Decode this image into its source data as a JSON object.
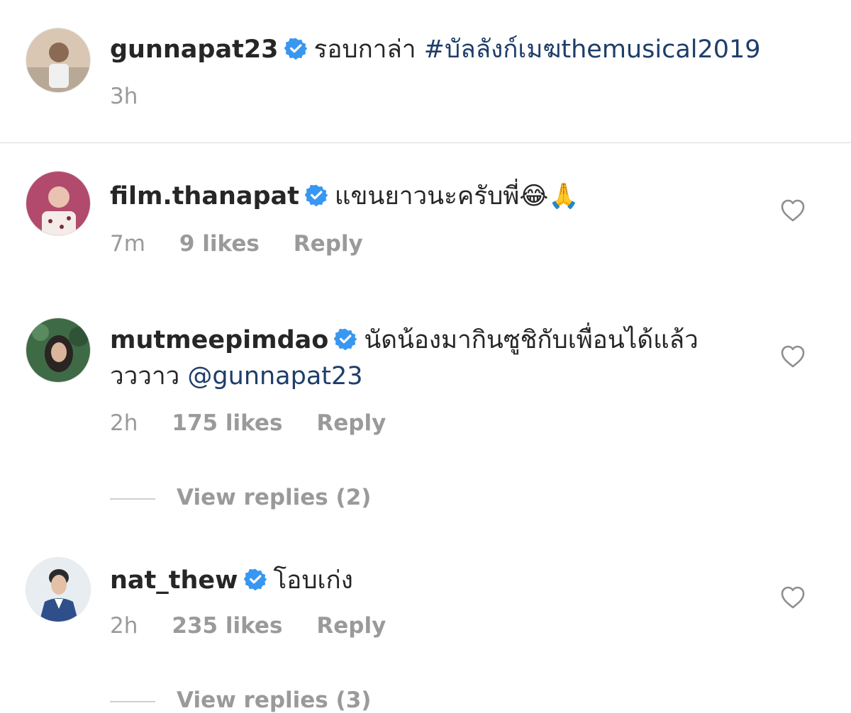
{
  "caption": {
    "username": "gunnapat23",
    "text": "รอบกาล่า",
    "hashtag": "#บัลลังก์เมฆthemusical2019",
    "time": "3h"
  },
  "comments": [
    {
      "username": "film.thanapat",
      "text": "แขนยาวนะครับพี่😂🙏",
      "time": "7m",
      "likes": "9 likes",
      "reply": "Reply"
    },
    {
      "username": "mutmeepimdao",
      "text_line1": "นัดน้องมากินซูชิกับเพื่อนได้แล้ว",
      "text_line2": "วววาว",
      "mention": "@gunnapat23",
      "time": "2h",
      "likes": "175 likes",
      "reply": "Reply",
      "view_replies": "View replies (2)"
    },
    {
      "username": "nat_thew",
      "text": "โอบเก่ง",
      "time": "2h",
      "likes": "235 likes",
      "reply": "Reply",
      "view_replies": "View replies (3)"
    }
  ],
  "colors": {
    "verified": "#3897f0",
    "link": "#1e3e6b",
    "muted": "#9a9a9a",
    "divider": "#dbdbdb"
  },
  "icons": {
    "verified": "verified-badge-icon",
    "heart": "heart-outline-icon"
  }
}
